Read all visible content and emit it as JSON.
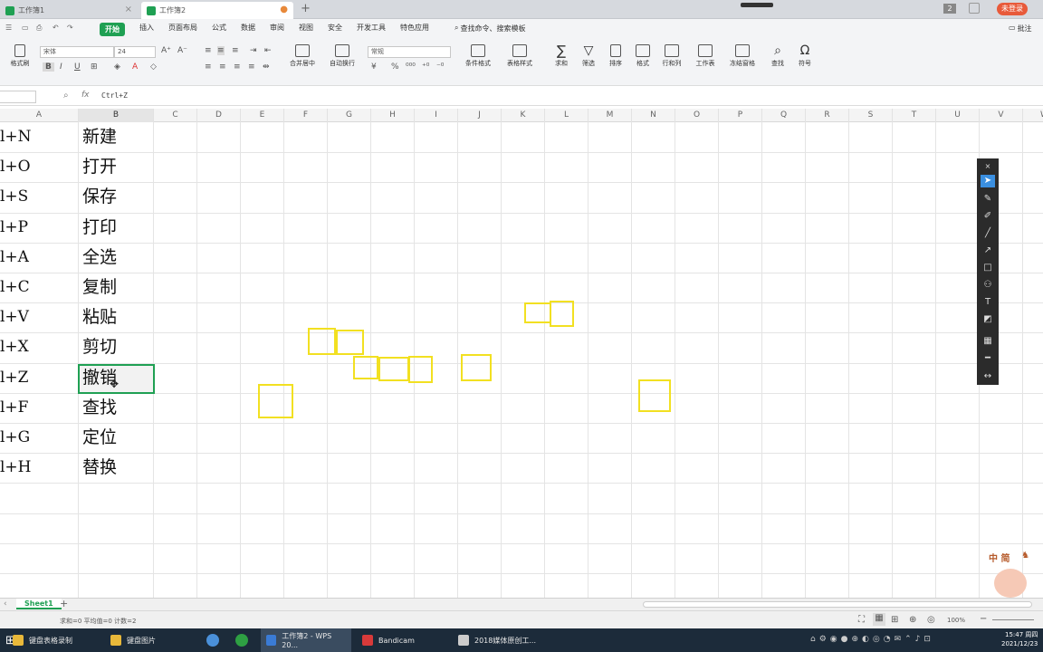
{
  "tabs": [
    {
      "label": "工作簿1"
    },
    {
      "label": "工作簿2"
    }
  ],
  "window": {
    "page_badge": "2",
    "user_button": "未登录"
  },
  "menu": {
    "items": [
      "开始",
      "插入",
      "页面布局",
      "公式",
      "数据",
      "审阅",
      "视图",
      "安全",
      "开发工具",
      "特色应用"
    ],
    "search_placeholder": "查找命令、搜索模板",
    "comment": "批注"
  },
  "ribbon": {
    "format_painter": "格式刷",
    "font_name": "宋体",
    "font_size": "24",
    "bold": "B",
    "italic": "I",
    "underline": "U",
    "merge_center": "合并居中",
    "wrap_text": "自动换行",
    "number_format": "常规",
    "percent": "%",
    "conditional_format": "条件格式",
    "table_style": "表格样式",
    "sum": "求和",
    "filter": "筛选",
    "sort": "排序",
    "format": "格式",
    "row_col": "行和列",
    "worksheet": "工作表",
    "freeze": "冻结窗格",
    "find": "查找",
    "symbol": "符号"
  },
  "formula_bar": {
    "fx": "fx",
    "content": "Ctrl+Z"
  },
  "columns": [
    "A",
    "B",
    "C",
    "D",
    "E",
    "F",
    "G",
    "H",
    "I",
    "J",
    "K",
    "L",
    "M",
    "N",
    "O",
    "P",
    "Q",
    "R",
    "S",
    "T",
    "U",
    "V",
    "W"
  ],
  "rows": [
    {
      "a": "l+N",
      "b": "新建"
    },
    {
      "a": "l+O",
      "b": "打开"
    },
    {
      "a": "l+S",
      "b": "保存"
    },
    {
      "a": "l+P",
      "b": "打印"
    },
    {
      "a": "l+A",
      "b": "全选"
    },
    {
      "a": "l+C",
      "b": "复制"
    },
    {
      "a": "l+V",
      "b": "粘贴"
    },
    {
      "a": "l+X",
      "b": "剪切"
    },
    {
      "a": "l+Z",
      "b": "撤销"
    },
    {
      "a": "l+F",
      "b": "查找"
    },
    {
      "a": "l+G",
      "b": "定位"
    },
    {
      "a": "l+H",
      "b": "替换"
    }
  ],
  "watermark": {
    "text": "中 简"
  },
  "sheet": {
    "name": "Sheet1",
    "add": "+"
  },
  "status": {
    "summary": "求和=0  平均值=0  计数=2",
    "zoom": "100%"
  },
  "taskbar": {
    "items": [
      {
        "label": "键盘表格录制",
        "color": "#e8b83a"
      },
      {
        "label": "键盘图片",
        "color": "#e8b83a"
      },
      {
        "label": "工作簿2 - WPS 20...",
        "color": "#3a7bd5"
      },
      {
        "label": "Bandicam",
        "color": "#d83a3a"
      },
      {
        "label": "2018媒体原创工...",
        "color": "#cccccc"
      }
    ],
    "time": "15:47 周四",
    "date": "2021/12/23"
  },
  "colors": {
    "accent": "#1fa053",
    "highlight": "#f2e021",
    "taskbar": "#1c2b3a"
  }
}
